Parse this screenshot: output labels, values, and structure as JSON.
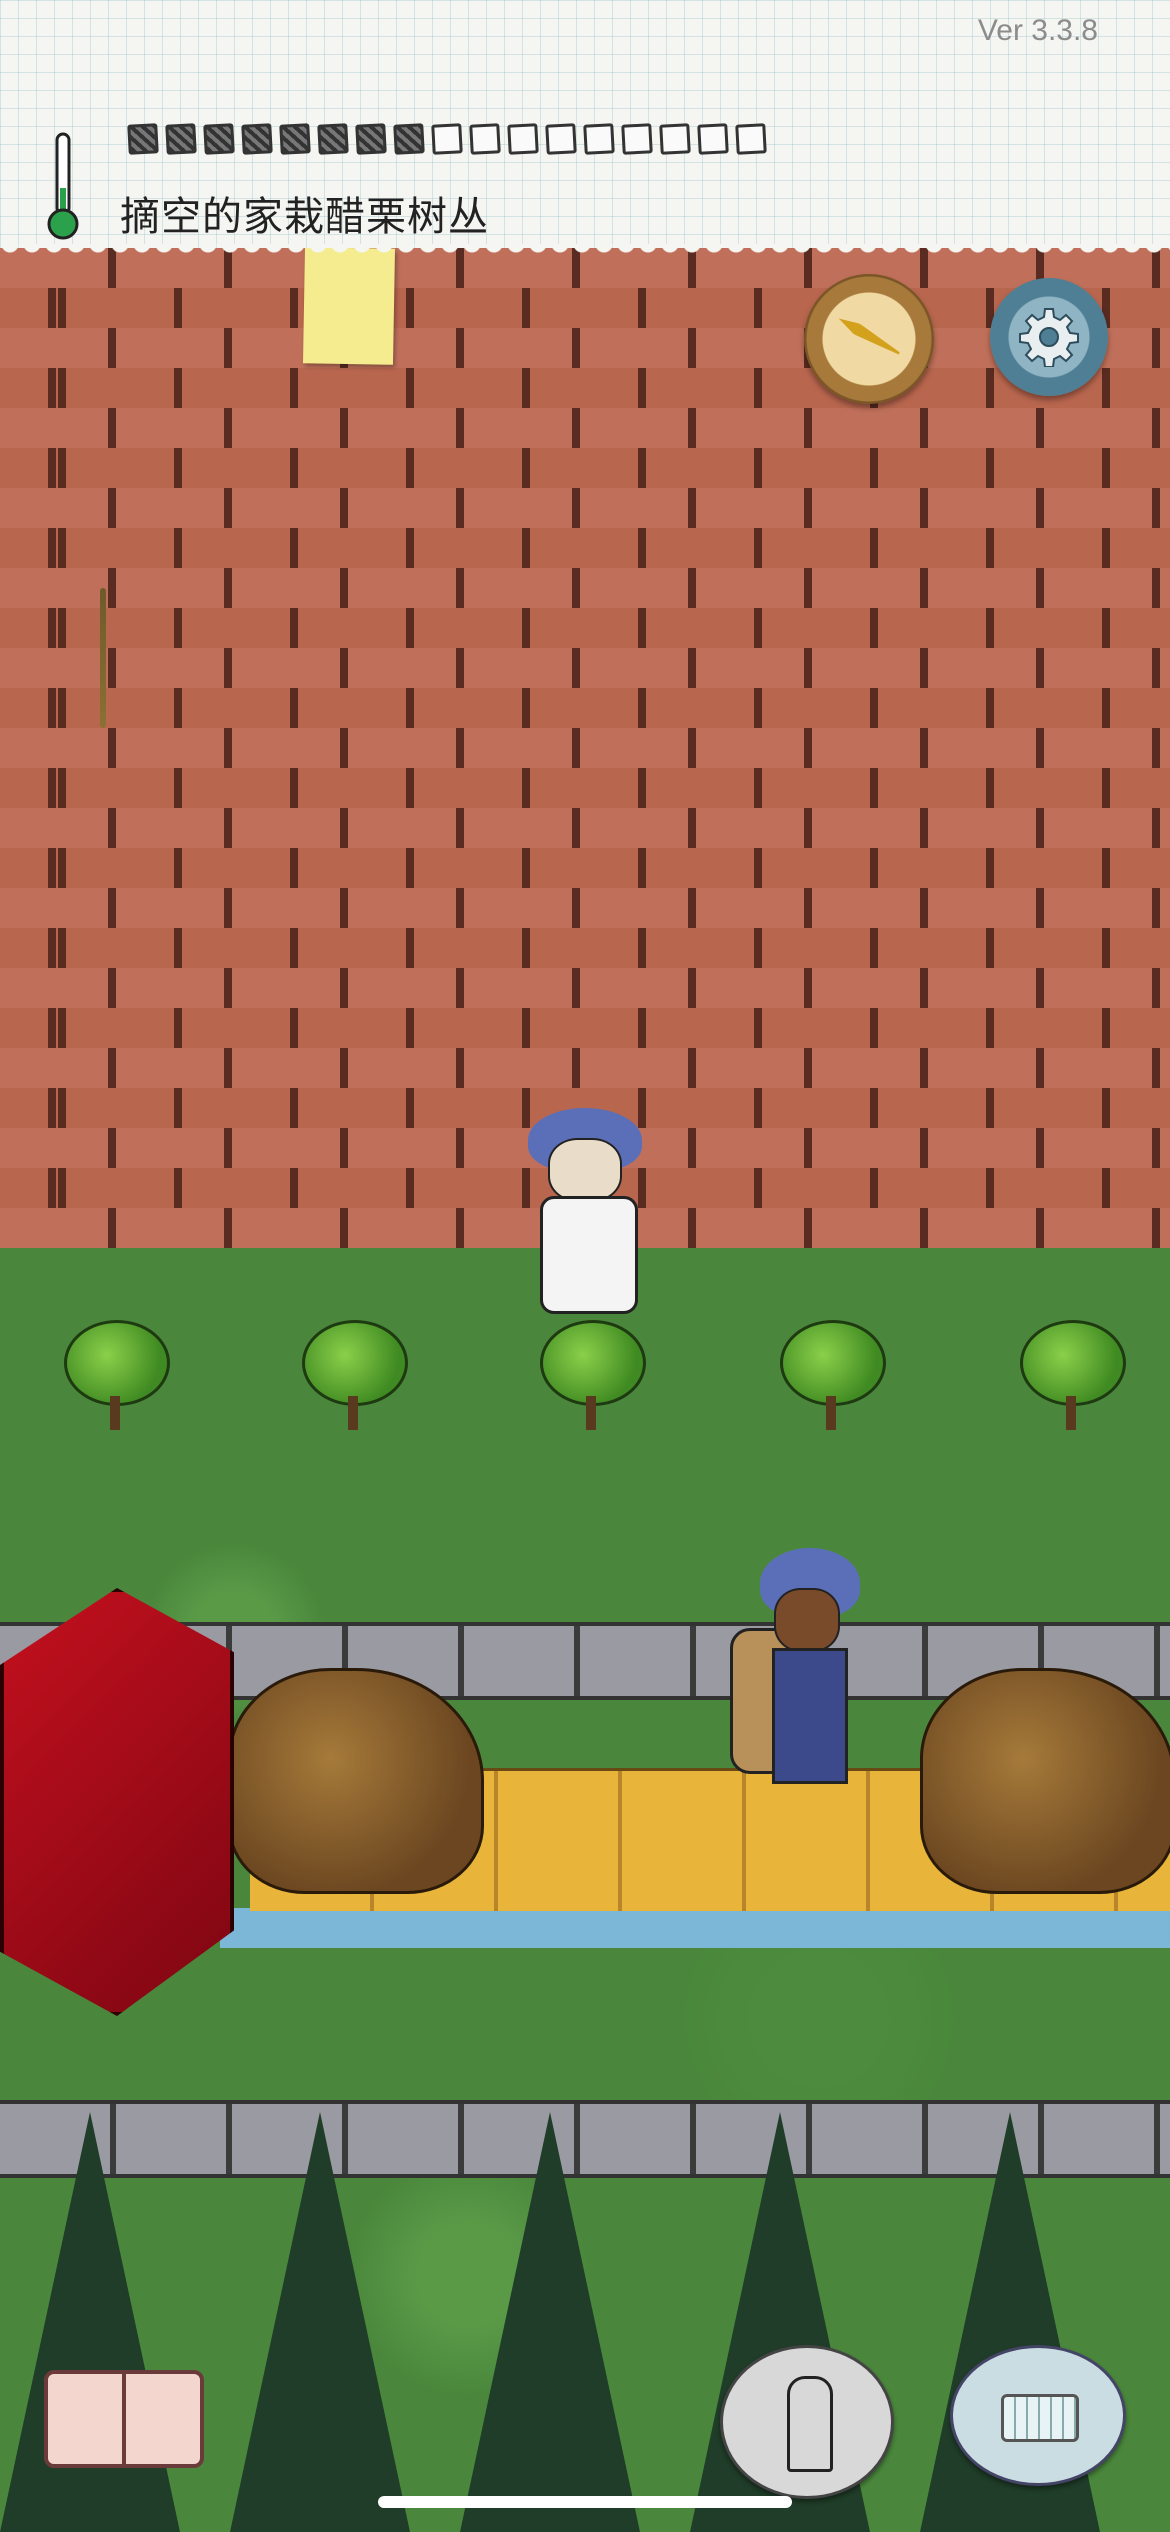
{
  "hud": {
    "version": "Ver 3.3.8",
    "status_text": "摘空的家栽醋栗树丛",
    "food_pips_total": 17,
    "food_pips_filled": 8
  },
  "icons": {
    "thermometer": "thermometer-icon",
    "compass": "compass-icon",
    "settings": "gear-icon",
    "book": "book-icon",
    "puppet": "puppet-icon",
    "keyboard": "keyboard-icon"
  },
  "colors": {
    "brick": "#b9664e",
    "grass": "#4a873c",
    "turban": "#5b6fb8",
    "red_box": "#c4101e",
    "bridge": "#e8b43a"
  }
}
